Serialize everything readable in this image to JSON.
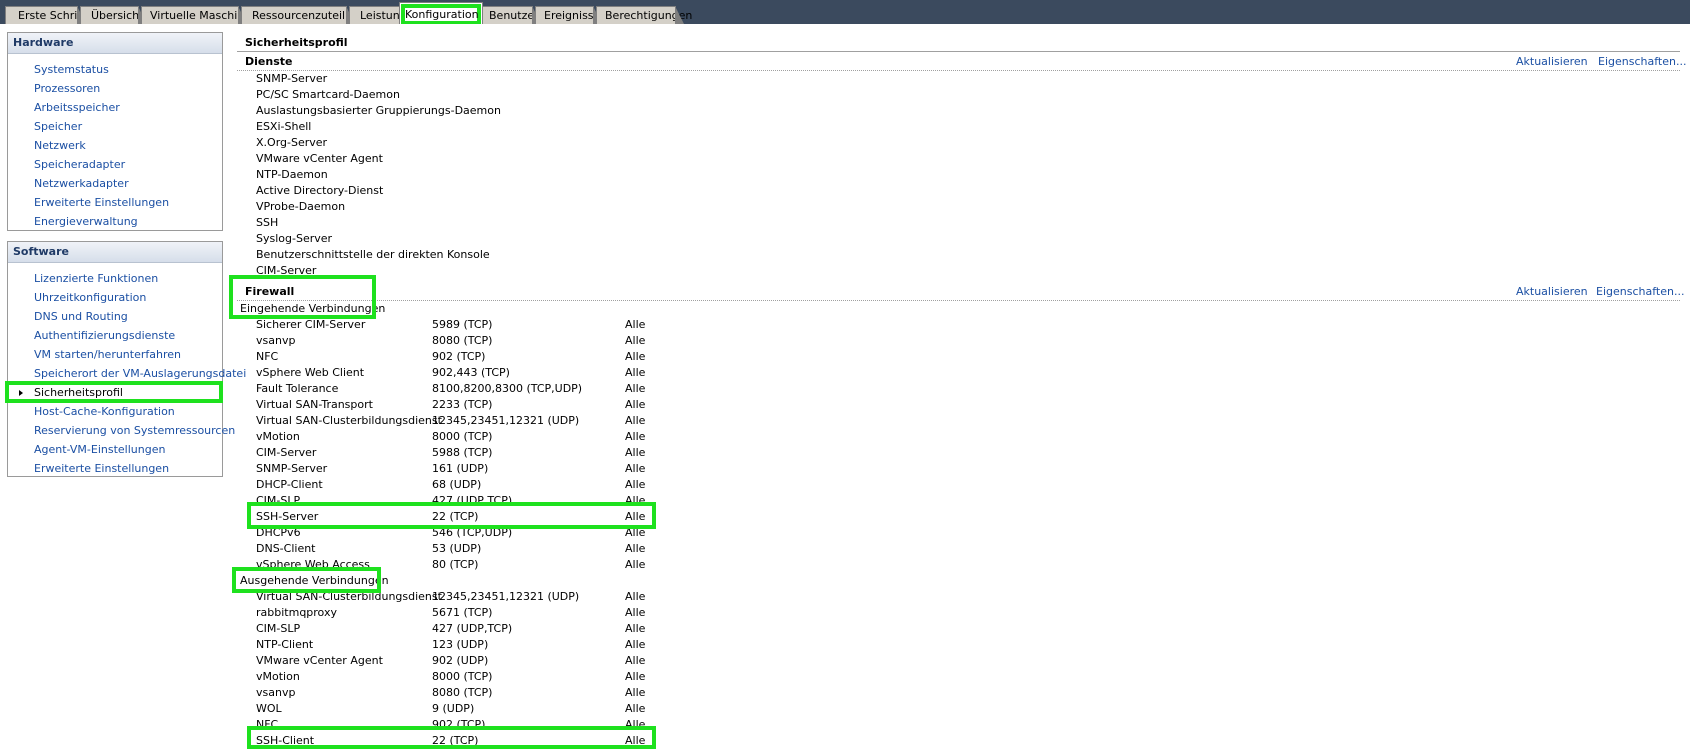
{
  "tabs": [
    {
      "label": "Erste Schritte",
      "active": false
    },
    {
      "label": "Übersicht",
      "active": false
    },
    {
      "label": "Virtuelle Maschinen",
      "active": false
    },
    {
      "label": "Ressourcenzuteilung",
      "active": false
    },
    {
      "label": "Leistung",
      "active": false
    },
    {
      "label": "Konfiguration",
      "active": true
    },
    {
      "label": "Benutzer",
      "active": false
    },
    {
      "label": "Ereignisse",
      "active": false
    },
    {
      "label": "Berechtigungen",
      "active": false
    }
  ],
  "hardware": {
    "title": "Hardware",
    "items": [
      "Systemstatus",
      "Prozessoren",
      "Arbeitsspeicher",
      "Speicher",
      "Netzwerk",
      "Speicheradapter",
      "Netzwerkadapter",
      "Erweiterte Einstellungen",
      "Energieverwaltung"
    ]
  },
  "software": {
    "title": "Software",
    "items": [
      "Lizenzierte Funktionen",
      "Uhrzeitkonfiguration",
      "DNS und Routing",
      "Authentifizierungsdienste",
      "VM starten/herunterfahren",
      "Speicherort der VM-Auslagerungsdatei",
      "Sicherheitsprofil",
      "Host-Cache-Konfiguration",
      "Reservierung von Systemressourcen",
      "Agent-VM-Einstellungen",
      "Erweiterte Einstellungen"
    ],
    "selected": "Sicherheitsprofil"
  },
  "main": {
    "title": "Sicherheitsprofil",
    "services": {
      "title": "Dienste",
      "refresh": "Aktualisieren",
      "properties": "Eigenschaften...",
      "items": [
        "SNMP-Server",
        "PC/SC Smartcard-Daemon",
        "Auslastungsbasierter Gruppierungs-Daemon",
        "ESXi-Shell",
        "X.Org-Server",
        "VMware vCenter Agent",
        "NTP-Daemon",
        "Active Directory-Dienst",
        "VProbe-Daemon",
        "SSH",
        "Syslog-Server",
        "Benutzerschnittstelle der direkten Konsole",
        "CIM-Server"
      ]
    },
    "firewall": {
      "title": "Firewall",
      "refresh": "Aktualisieren",
      "properties": "Eigenschaften...",
      "incoming_label": "Eingehende Verbindungen",
      "incoming": [
        {
          "name": "Sicherer CIM-Server",
          "ports": "5989 (TCP)",
          "allowed": "Alle"
        },
        {
          "name": "vsanvp",
          "ports": "8080 (TCP)",
          "allowed": "Alle"
        },
        {
          "name": "NFC",
          "ports": "902 (TCP)",
          "allowed": "Alle"
        },
        {
          "name": "vSphere Web Client",
          "ports": "902,443 (TCP)",
          "allowed": "Alle"
        },
        {
          "name": "Fault Tolerance",
          "ports": "8100,8200,8300 (TCP,UDP)",
          "allowed": "Alle"
        },
        {
          "name": "Virtual SAN-Transport",
          "ports": "2233 (TCP)",
          "allowed": "Alle"
        },
        {
          "name": "Virtual SAN-Clusterbildungsdienst",
          "ports": "12345,23451,12321 (UDP)",
          "allowed": "Alle"
        },
        {
          "name": "vMotion",
          "ports": "8000 (TCP)",
          "allowed": "Alle"
        },
        {
          "name": "CIM-Server",
          "ports": "5988 (TCP)",
          "allowed": "Alle"
        },
        {
          "name": "SNMP-Server",
          "ports": "161 (UDP)",
          "allowed": "Alle"
        },
        {
          "name": "DHCP-Client",
          "ports": "68 (UDP)",
          "allowed": "Alle"
        },
        {
          "name": "CIM-SLP",
          "ports": "427 (UDP,TCP)",
          "allowed": "Alle"
        },
        {
          "name": "SSH-Server",
          "ports": "22 (TCP)",
          "allowed": "Alle"
        },
        {
          "name": "DHCPv6",
          "ports": "546 (TCP,UDP)",
          "allowed": "Alle"
        },
        {
          "name": "DNS-Client",
          "ports": "53 (UDP)",
          "allowed": "Alle"
        },
        {
          "name": "vSphere Web Access",
          "ports": "80 (TCP)",
          "allowed": "Alle"
        }
      ],
      "outgoing_label": "Ausgehende Verbindungen",
      "outgoing": [
        {
          "name": "Virtual SAN-Clusterbildungsdienst",
          "ports": "12345,23451,12321 (UDP)",
          "allowed": "Alle"
        },
        {
          "name": "rabbitmqproxy",
          "ports": "5671 (TCP)",
          "allowed": "Alle"
        },
        {
          "name": "CIM-SLP",
          "ports": "427 (UDP,TCP)",
          "allowed": "Alle"
        },
        {
          "name": "NTP-Client",
          "ports": "123 (UDP)",
          "allowed": "Alle"
        },
        {
          "name": "VMware vCenter Agent",
          "ports": "902 (UDP)",
          "allowed": "Alle"
        },
        {
          "name": "vMotion",
          "ports": "8000 (TCP)",
          "allowed": "Alle"
        },
        {
          "name": "vsanvp",
          "ports": "8080 (TCP)",
          "allowed": "Alle"
        },
        {
          "name": "WOL",
          "ports": "9 (UDP)",
          "allowed": "Alle"
        },
        {
          "name": "NFC",
          "ports": "902 (TCP)",
          "allowed": "Alle"
        },
        {
          "name": "SSH-Client",
          "ports": "22 (TCP)",
          "allowed": "Alle"
        }
      ]
    }
  },
  "colors": {
    "highlight": "#1ee11e",
    "link": "#1b4fa3",
    "tabbar": "#3b4a5e"
  }
}
